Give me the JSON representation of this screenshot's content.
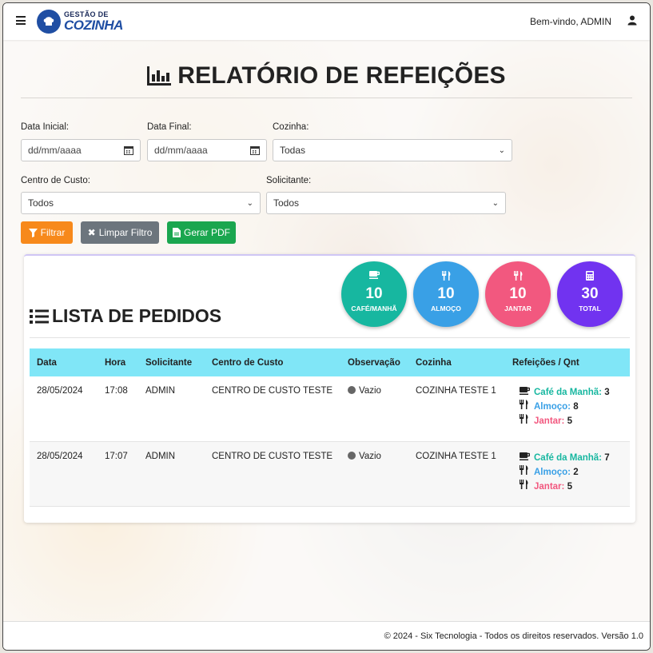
{
  "nav": {
    "brand_line1": "GESTÃO DE",
    "brand_line2": "COZINHA",
    "welcome": "Bem-vindo, ADMIN"
  },
  "page": {
    "title": "RELATÓRIO DE REFEIÇÕES"
  },
  "filters": {
    "data_inicial_label": "Data Inicial:",
    "data_inicial_placeholder": "dd/mm/aaaa",
    "data_final_label": "Data Final:",
    "data_final_placeholder": "dd/mm/aaaa",
    "cozinha_label": "Cozinha:",
    "cozinha_value": "Todas",
    "centro_custo_label": "Centro de Custo:",
    "centro_custo_value": "Todos",
    "solicitante_label": "Solicitante:",
    "solicitante_value": "Todos",
    "btn_filtrar": "Filtrar",
    "btn_limpar": "Limpar Filtro",
    "btn_pdf": "Gerar PDF"
  },
  "colors": {
    "filtrar": "#f7891b",
    "limpar": "#6c757d",
    "pdf": "#1aa64f",
    "cafe": "#17b7a0",
    "almoco": "#39a0e6",
    "jantar": "#f2587f",
    "total": "#7133f0",
    "header_row": "#80e6f7"
  },
  "list": {
    "title": "LISTA DE PEDIDOS",
    "stats": [
      {
        "icon": "coffee-icon",
        "value": "10",
        "caption": "CAFÉ/MANHÃ"
      },
      {
        "icon": "utensils-icon",
        "value": "10",
        "caption": "ALMOÇO"
      },
      {
        "icon": "utensils-icon",
        "value": "10",
        "caption": "JANTAR"
      },
      {
        "icon": "calculator-icon",
        "value": "30",
        "caption": "TOTAL"
      }
    ],
    "columns": [
      "Data",
      "Hora",
      "Solicitante",
      "Centro de Custo",
      "Observação",
      "Cozinha",
      "Refeições / Qnt"
    ],
    "rows": [
      {
        "data": "28/05/2024",
        "hora": "17:08",
        "solicitante": "ADMIN",
        "centro": "CENTRO DE CUSTO TESTE",
        "observacao": "Vazio",
        "cozinha": "COZINHA TESTE 1",
        "cafe_label": "Café da Manhã:",
        "cafe_qty": "3",
        "almoco_label": "Almoço:",
        "almoco_qty": "8",
        "jantar_label": "Jantar:",
        "jantar_qty": "5"
      },
      {
        "data": "28/05/2024",
        "hora": "17:07",
        "solicitante": "ADMIN",
        "centro": "CENTRO DE CUSTO TESTE",
        "observacao": "Vazio",
        "cozinha": "COZINHA TESTE 1",
        "cafe_label": "Café da Manhã:",
        "cafe_qty": "7",
        "almoco_label": "Almoço:",
        "almoco_qty": "2",
        "jantar_label": "Jantar:",
        "jantar_qty": "5"
      }
    ]
  },
  "footer": {
    "text": "© 2024 - Six Tecnologia - Todos os direitos reservados. Versão 1.0"
  }
}
